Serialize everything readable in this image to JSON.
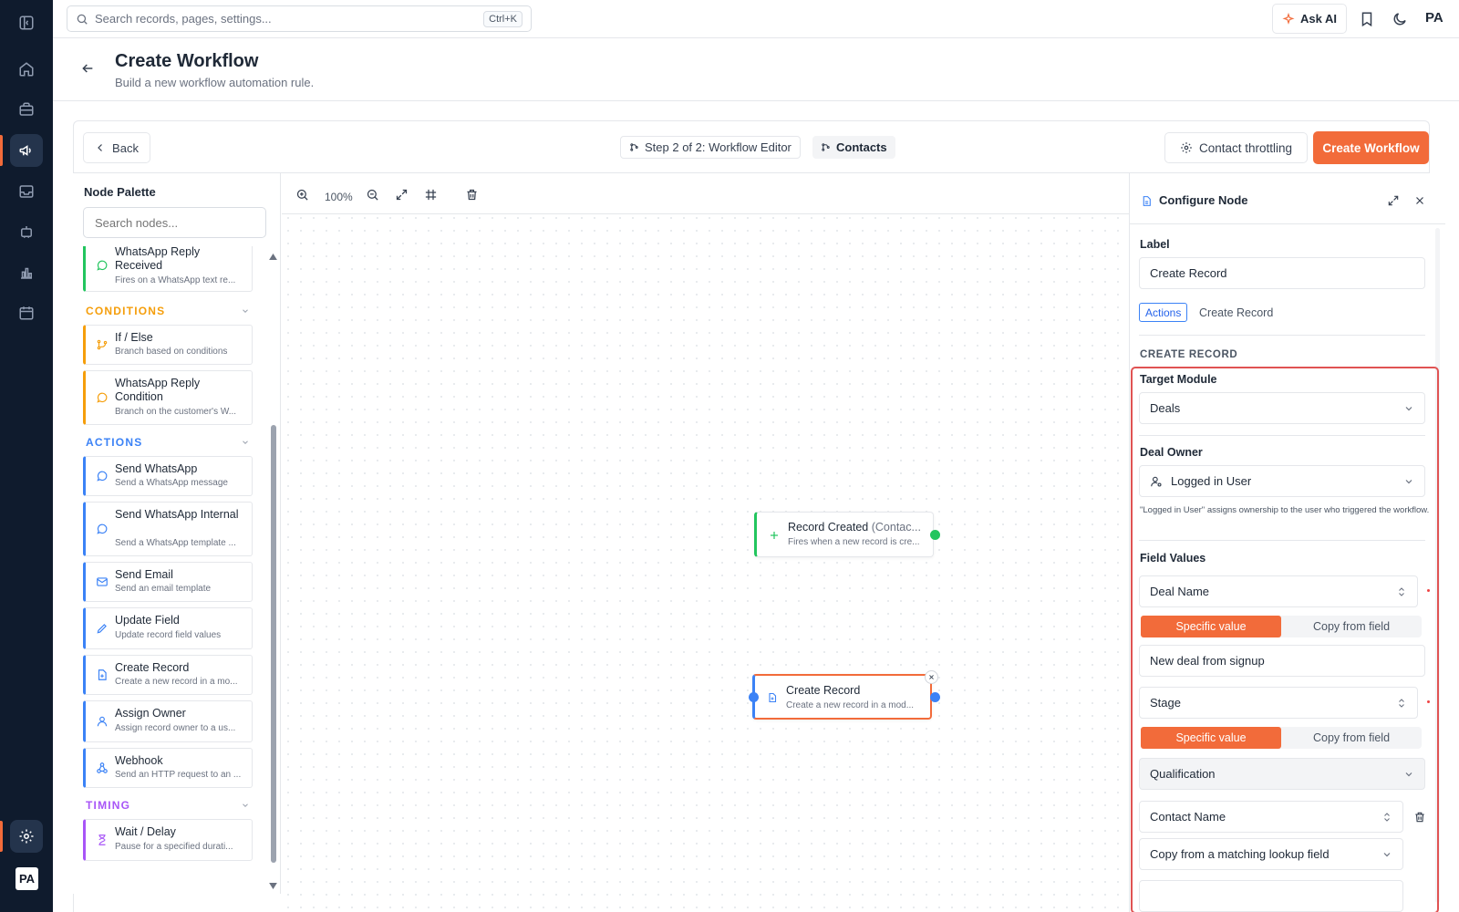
{
  "topbar": {
    "search_placeholder": "Search records, pages, settings...",
    "search_shortcut": "Ctrl+K",
    "ask_ai_label": "Ask AI",
    "avatar_initials": "PA"
  },
  "sidebar": {
    "avatar_initials": "PA",
    "items": [
      "toggle-sidebar-icon",
      "home-icon",
      "briefcase-icon",
      "megaphone-icon",
      "inbox-icon",
      "robot-icon",
      "bar-chart-icon",
      "calendar-icon",
      "settings-icon"
    ],
    "active": "megaphone-icon"
  },
  "page": {
    "title": "Create Workflow",
    "subtitle": "Build a new workflow automation rule."
  },
  "editor_header": {
    "back_label": "Back",
    "step_label": "Step 2 of 2: Workflow Editor",
    "module_label": "Contacts",
    "throttling_label": "Contact throttling",
    "create_label": "Create Workflow"
  },
  "palette": {
    "title": "Node Palette",
    "search_placeholder": "Search nodes...",
    "sections": {
      "conditions": "CONDITIONS",
      "actions": "ACTIONS",
      "timing": "TIMING"
    },
    "nodes": {
      "whatsapp_reply_received": {
        "title": "WhatsApp Reply Received",
        "desc": "Fires on a WhatsApp text re..."
      },
      "if_else": {
        "title": "If / Else",
        "desc": "Branch based on conditions"
      },
      "whatsapp_reply_condition": {
        "title": "WhatsApp Reply Condition",
        "desc": "Branch on the customer's W..."
      },
      "send_whatsapp": {
        "title": "Send WhatsApp",
        "desc": "Send a WhatsApp message"
      },
      "send_whatsapp_internal": {
        "title": "Send WhatsApp Internal",
        "desc": "Send a WhatsApp template ..."
      },
      "send_email": {
        "title": "Send Email",
        "desc": "Send an email template"
      },
      "update_field": {
        "title": "Update Field",
        "desc": "Update record field values"
      },
      "create_record": {
        "title": "Create Record",
        "desc": "Create a new record in a mo..."
      },
      "assign_owner": {
        "title": "Assign Owner",
        "desc": "Assign record owner to a us..."
      },
      "webhook": {
        "title": "Webhook",
        "desc": "Send an HTTP request to an ..."
      },
      "wait_delay": {
        "title": "Wait / Delay",
        "desc": "Pause for a specified durati..."
      }
    }
  },
  "canvas": {
    "zoom": "100%",
    "trigger_node": {
      "title": "Record Created",
      "module": "(Contac...",
      "desc": "Fires when a new record is cre..."
    },
    "action_node": {
      "title": "Create Record",
      "desc": "Create a new record in a mod..."
    }
  },
  "config": {
    "title": "Configure Node",
    "label_heading": "Label",
    "label_value": "Create Record",
    "category_badge": "Actions",
    "category_type": "Create Record",
    "section_heading": "CREATE RECORD",
    "target_module_label": "Target Module",
    "target_module_value": "Deals",
    "deal_owner_label": "Deal Owner",
    "deal_owner_value": "Logged in User",
    "deal_owner_hint": "\"Logged in User\" assigns ownership to the user who triggered the workflow.",
    "field_values_label": "Field Values",
    "fields": [
      {
        "name": "Deal Name",
        "mode_specific": "Specific value",
        "mode_copy": "Copy from field",
        "value": "New deal from signup"
      },
      {
        "name": "Stage",
        "mode_specific": "Specific value",
        "mode_copy": "Copy from field",
        "value": "Qualification"
      },
      {
        "name": "Contact Name",
        "value": "Copy from a matching lookup field"
      }
    ]
  },
  "colors": {
    "accent": "#f26b3a",
    "sidebar_bg": "#0f1b2d",
    "trigger_green": "#22c55e",
    "action_blue": "#3b82f6",
    "condition_amber": "#f59e0b",
    "timing_purple": "#a855f7",
    "highlight_red": "#e05353"
  }
}
